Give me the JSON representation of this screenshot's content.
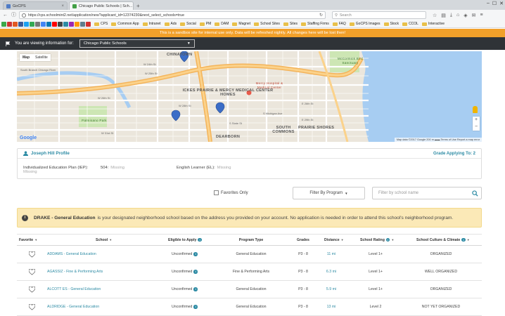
{
  "browser": {
    "tabs": [
      {
        "title": "GoCPS",
        "active": false
      },
      {
        "title": "Chicago Public Schools | Sch...",
        "active": true
      }
    ],
    "url": "https://cps.schoolmint2.net/application/new?applicant_id=12374230&next_select_schools=true",
    "search_placeholder": "Search",
    "bookmarks": [
      "CPS",
      "Common App",
      "Intranet",
      "Ads",
      "Social",
      "PM",
      "DAM",
      "Magnet",
      "School Sites",
      "Sites",
      "Staffing Firms",
      "FAQ",
      "GoCPS Images",
      "Stock",
      "CCOL",
      "Interactive"
    ]
  },
  "sandbox_notice": "This is a sandbox site for internal use only. Data will be refreshed nightly. All changes here will be lost then!",
  "viewing": {
    "label": "You are viewing information for:",
    "selected": "Chicago Public Schools"
  },
  "map": {
    "type_map": "Map",
    "type_satellite": "Satellite",
    "labels": {
      "chinatown": "CHINATOWN",
      "ickes": "ICKES PRAIRIE & MERCY MEDICAL CENTER HOMES",
      "mercy": "Mercy Hospital & Medical Center",
      "south_commons": "SOUTH COMMONS",
      "prairie_shores": "PRAIRIE SHORES",
      "dearborn": "DEARBORN",
      "mccormick": "McCormick Bird Sanctuary",
      "palmisano": "Palmisano Park"
    },
    "streets": [
      "W 24th St",
      "W 25th St",
      "W 26th St",
      "W 28th St",
      "W 31st St",
      "E 26th St",
      "E 29th St",
      "S State St",
      "S Michigan Ave",
      "South Branch Chicago River"
    ],
    "footer": "Map data ©2017 Google   200 m ▬▬   Terms of Use   Report a map error",
    "google": "Google"
  },
  "profile": {
    "name": "Joseph Hill Profile",
    "grade_applying": "Grade Applying To: 2",
    "iep_label": "Individualized Education Plan (IEP):",
    "iep_value": "Missing",
    "p504_label": "504:",
    "p504_value": "Missing",
    "el_label": "English Learner (EL):",
    "el_value": "Missing"
  },
  "filters": {
    "favorites_only": "Favorites Only",
    "filter_by_program": "Filter By Program",
    "search_placeholder": "Filter by school name"
  },
  "alert": {
    "school": "DRAKE - General Education",
    "text": "is your designated neighborhood school based on the address you provided on your account. No application is needed in order to attend this school's neighborhood program."
  },
  "table": {
    "headers": {
      "favorite": "Favorite",
      "school": "School",
      "eligible": "Eligible to Apply",
      "program": "Program Type",
      "grades": "Grades",
      "distance": "Distance",
      "rating": "School Rating",
      "culture": "School Culture & Climate"
    },
    "rows": [
      {
        "school": "ADDAMS - General Education",
        "eligible": "Unconfirmed",
        "program": "General Education",
        "grades": "P3 - 8",
        "distance": "11 mi",
        "rating": "Level 1+",
        "culture": "ORGANIZED"
      },
      {
        "school": "AGASSIZ - Fine & Performing Arts",
        "eligible": "Unconfirmed",
        "program": "Fine & Performing Arts",
        "grades": "P3 - 8",
        "distance": "6.3 mi",
        "rating": "Level 1+",
        "culture": "WELL ORGANIZED"
      },
      {
        "school": "ALCOTT ES - General Education",
        "eligible": "Unconfirmed",
        "program": "General Education",
        "grades": "P3 - 8",
        "distance": "5.9 mi",
        "rating": "Level 1+",
        "culture": "ORGANIZED"
      },
      {
        "school": "ALDRIDGE - General Education",
        "eligible": "Unconfirmed",
        "program": "General Education",
        "grades": "P3 - 8",
        "distance": "13 mi",
        "rating": "Level 2",
        "culture": "NOT YET ORGANIZED"
      }
    ]
  },
  "colors": {
    "accent": "#2d8ba4",
    "sandbox": "#f1a02a",
    "alert_bg": "#fbe9b7",
    "dark_bar": "#2f3337"
  }
}
